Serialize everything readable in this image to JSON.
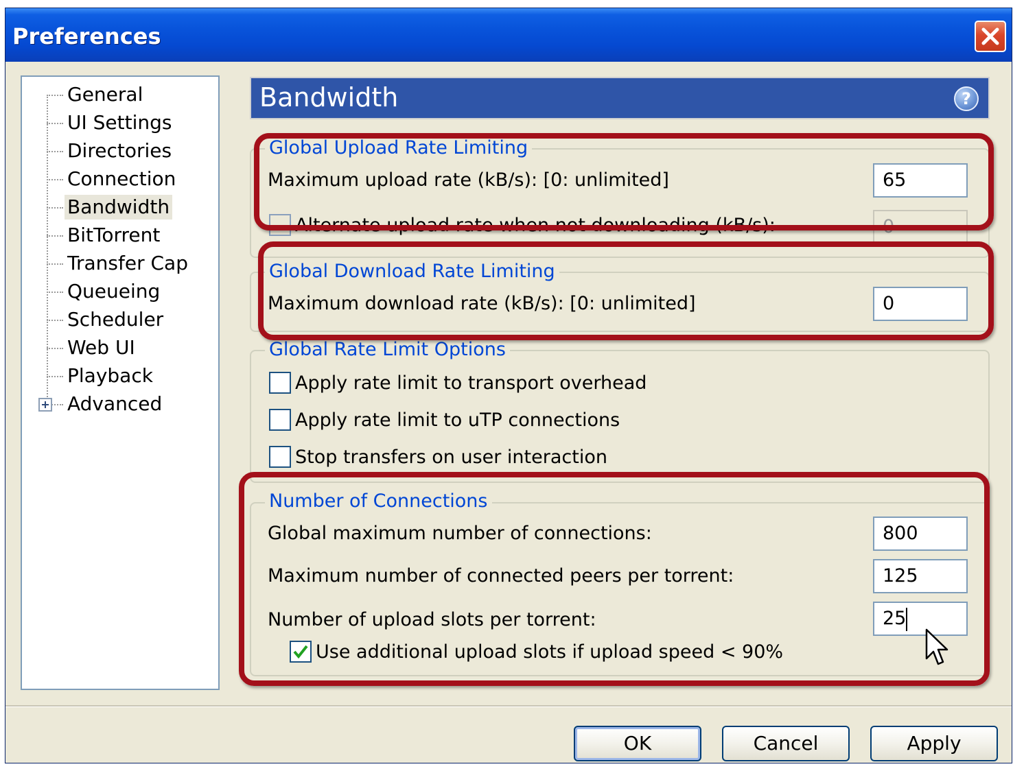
{
  "window": {
    "title": "Preferences"
  },
  "sidebar": {
    "items": [
      {
        "label": "General"
      },
      {
        "label": "UI Settings"
      },
      {
        "label": "Directories"
      },
      {
        "label": "Connection"
      },
      {
        "label": "Bandwidth",
        "selected": true
      },
      {
        "label": "BitTorrent"
      },
      {
        "label": "Transfer Cap"
      },
      {
        "label": "Queueing"
      },
      {
        "label": "Scheduler"
      },
      {
        "label": "Web UI"
      },
      {
        "label": "Playback"
      },
      {
        "label": "Advanced",
        "expandable": true
      }
    ]
  },
  "page": {
    "title": "Bandwidth",
    "help_icon": "help-icon"
  },
  "upload": {
    "group_title": "Global Upload Rate Limiting",
    "max_label": "Maximum upload rate (kB/s): [0: unlimited]",
    "max_value": "65",
    "alt_label": "Alternate upload rate when not downloading (kB/s):",
    "alt_value": "0"
  },
  "download": {
    "group_title": "Global Download Rate Limiting",
    "max_label": "Maximum download rate (kB/s): [0: unlimited]",
    "max_value": "0"
  },
  "options": {
    "group_title": "Global Rate Limit Options",
    "overhead_label": "Apply rate limit to transport overhead",
    "utp_label": "Apply rate limit to uTP connections",
    "stop_label": "Stop transfers on user interaction"
  },
  "connections": {
    "group_title": "Number of Connections",
    "global_label": "Global maximum number of connections:",
    "global_value": "800",
    "peers_label": "Maximum number of connected peers per torrent:",
    "peers_value": "125",
    "slots_label": "Number of upload slots per torrent:",
    "slots_value": "25",
    "extra_slots_label": "Use additional upload slots if upload speed < 90%",
    "extra_slots_checked": true
  },
  "buttons": {
    "ok": "OK",
    "cancel": "Cancel",
    "apply": "Apply"
  },
  "colors": {
    "highlight": "#A3101A",
    "title_bar": "#0853DA",
    "group_title": "#0046D5",
    "header_bar": "#2F55A8"
  }
}
